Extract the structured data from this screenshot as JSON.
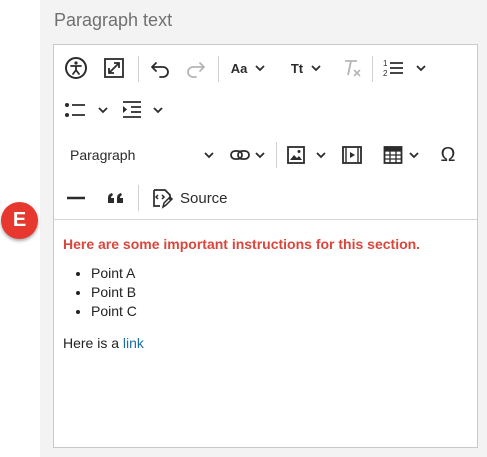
{
  "field": {
    "label": "Paragraph text"
  },
  "toolbar": {
    "row1": [
      {
        "icon": "accessibility-icon"
      },
      {
        "icon": "fullscreen-icon"
      },
      {
        "icon": "undo-icon"
      },
      {
        "icon": "redo-icon",
        "disabled": true
      },
      {
        "icon": "font-size-icon",
        "text": "Aa"
      },
      {
        "icon": "font-style-icon",
        "text": "Tt"
      },
      {
        "icon": "remove-format-icon",
        "disabled": true
      },
      {
        "icon": "numbered-list-icon"
      }
    ],
    "row2": [
      {
        "icon": "bulleted-list-icon"
      },
      {
        "icon": "indent-icon"
      }
    ],
    "paragraph_select": "Paragraph",
    "row3": [
      {
        "icon": "link-icon"
      },
      {
        "icon": "image-icon"
      },
      {
        "icon": "media-icon"
      },
      {
        "icon": "table-icon"
      },
      {
        "icon": "special-characters-icon",
        "text": "Ω"
      }
    ],
    "row4": [
      {
        "icon": "horizontal-line-icon"
      },
      {
        "icon": "blockquote-icon"
      }
    ],
    "source_label": "Source"
  },
  "content": {
    "important_text": "Here are some important instructions for this section.",
    "list_items": [
      "Point A",
      "Point B",
      "Point C"
    ],
    "link_prefix": "Here is a ",
    "link_text": "link"
  },
  "badge": {
    "letter": "E",
    "color": "#e6382f"
  },
  "colors": {
    "important": "#d9473c",
    "link": "#1a6fa3",
    "panel": "#f3f3f3"
  }
}
